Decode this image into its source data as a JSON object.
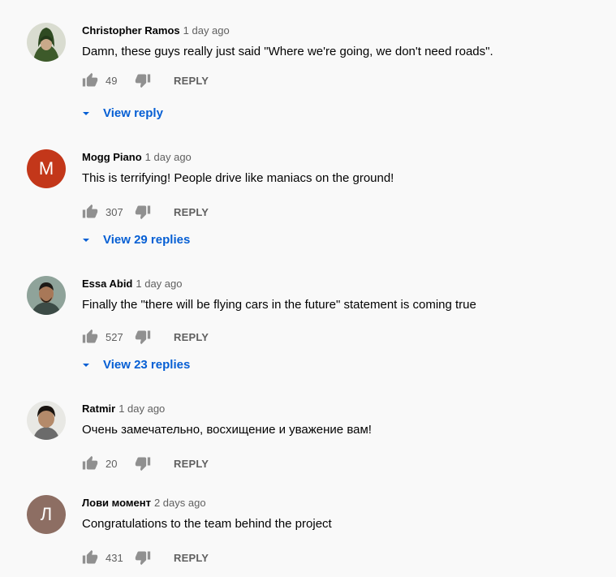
{
  "comments": [
    {
      "author": "Christopher Ramos",
      "time": "1 day ago",
      "text": "Damn, these guys really just said \"Where we're going, we don't need roads\".",
      "likes": "49",
      "reply_label": "REPLY",
      "view_replies": "View reply",
      "avatar_icon": "hooded-figure-avatar"
    },
    {
      "author": "Mogg Piano",
      "time": "1 day ago",
      "text": "This is terrifying! People drive like maniacs on the ground!",
      "likes": "307",
      "reply_label": "REPLY",
      "view_replies": "View 29 replies",
      "avatar_letter": "M",
      "avatar_color": "#c3371a"
    },
    {
      "author": "Essa Abid",
      "time": "1 day ago",
      "text": "Finally the \"there will be flying cars in the future\" statement is coming true",
      "likes": "527",
      "reply_label": "REPLY",
      "view_replies": "View 23 replies",
      "avatar_icon": "person-photo-avatar"
    },
    {
      "author": "Ratmir",
      "time": "1 day ago",
      "text": "Очень замечательно, восхищение и уважение вам!",
      "likes": "20",
      "reply_label": "REPLY",
      "avatar_icon": "person-photo-avatar"
    },
    {
      "author": "Лови момент",
      "time": "2 days ago",
      "text": "Congratulations to the team behind the project",
      "likes": "431",
      "reply_label": "REPLY",
      "avatar_letter": "Л",
      "avatar_color": "#8d6e63"
    }
  ],
  "colors": {
    "link": "#065fd4",
    "secondary_text": "#606060",
    "background": "#f9f9f9"
  }
}
